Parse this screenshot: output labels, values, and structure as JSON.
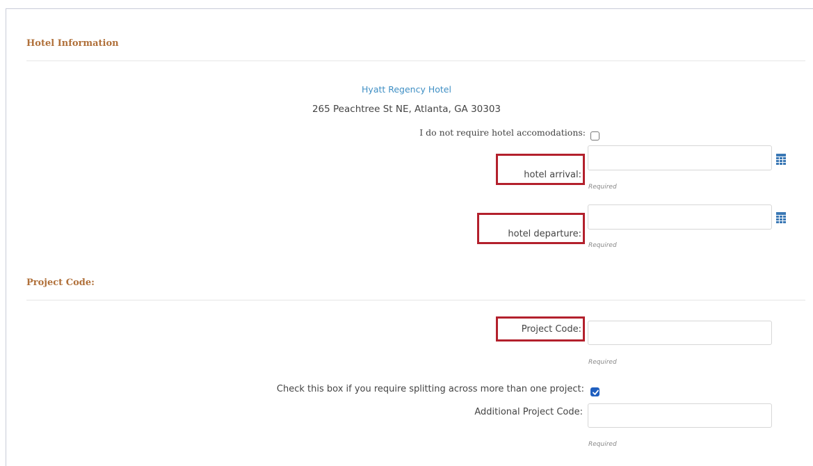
{
  "hotel_section": {
    "title": "Hotel Information",
    "hotel_name": "Hyatt Regency Hotel",
    "hotel_address": "265 Peachtree St NE, Atlanta, GA 30303",
    "no_accommodation_label": "I do not require hotel accomodations:",
    "no_accommodation_checked": false,
    "arrival": {
      "label": "hotel arrival:",
      "value": "",
      "required_text": "Required"
    },
    "departure": {
      "label": "hotel departure:",
      "value": "",
      "required_text": "Required"
    }
  },
  "project_section": {
    "title": "Project Code:",
    "project_code": {
      "label": "Project Code:",
      "value": "",
      "required_text": "Required"
    },
    "split_label": "Check this box if you require splitting across more than one project:",
    "split_checked": true,
    "additional_code": {
      "label": "Additional Project Code:",
      "value": "",
      "required_text": "Required"
    }
  },
  "colors": {
    "section_title": "#b0703a",
    "hotel_link": "#3f8fc4",
    "highlight_border": "#b3202c",
    "checkbox_checked": "#1f5fbf",
    "calendar_icon": "#3a78b5"
  },
  "icons": {
    "calendar": "calendar-icon",
    "checkmark": "checkmark-icon"
  }
}
